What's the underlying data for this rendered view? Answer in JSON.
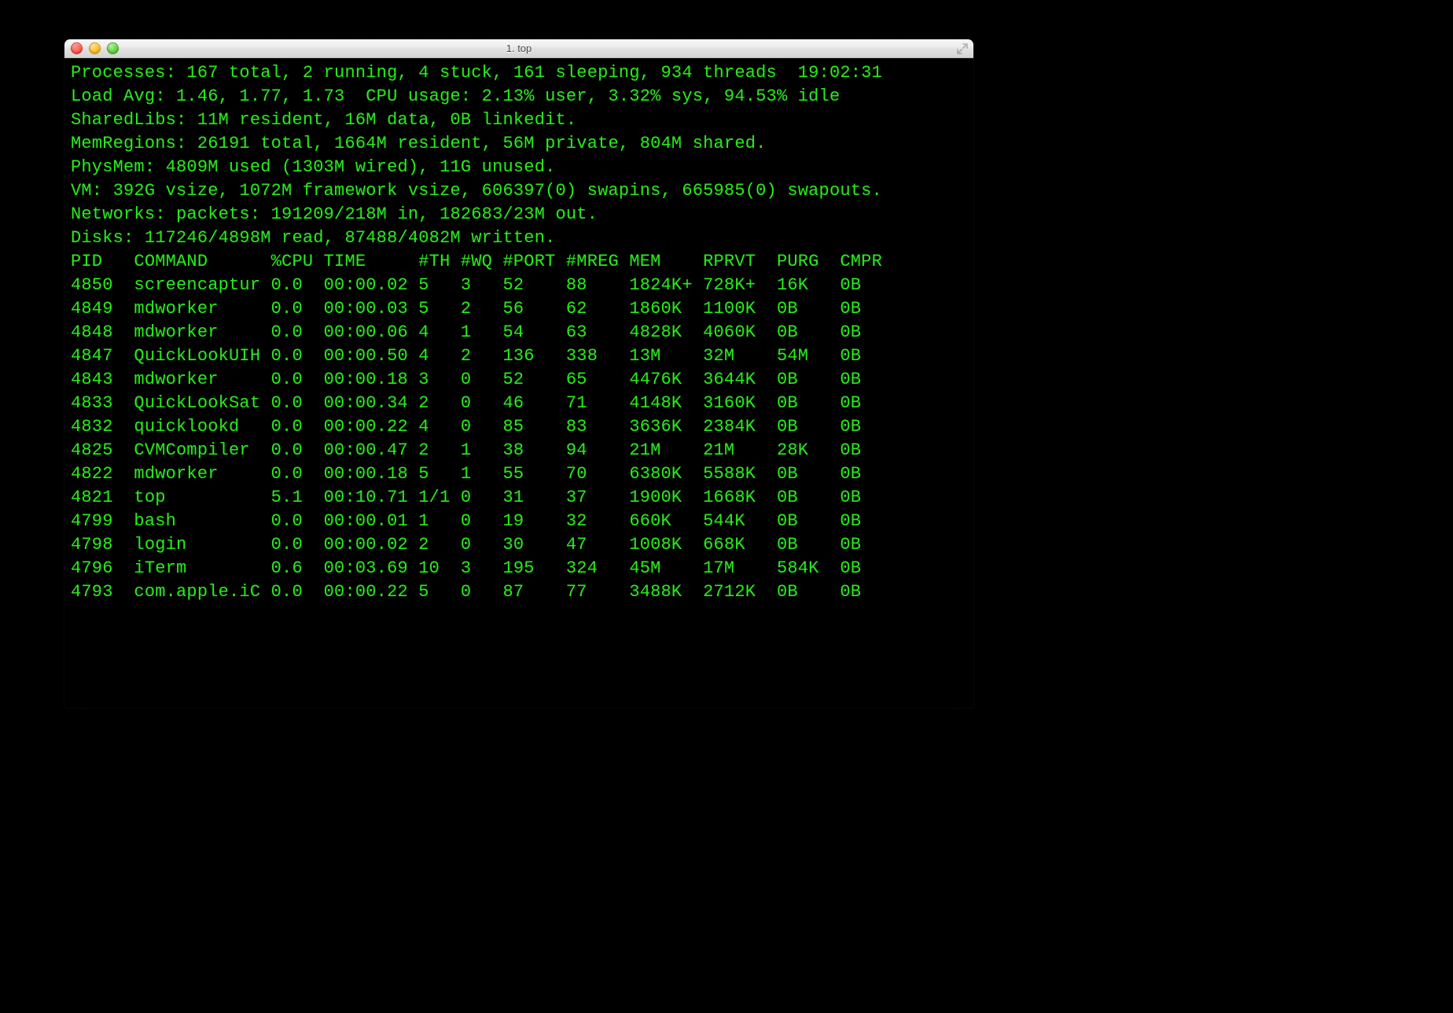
{
  "window": {
    "title": "1. top"
  },
  "summary": {
    "processes_line": {
      "prefix": "Processes: ",
      "total": "167 total",
      "running": "2 running",
      "stuck": "4 stuck",
      "sleeping": "161 sleeping",
      "threads": "934 threads",
      "clock": "19:02:31"
    },
    "load_line": "Load Avg: 1.46, 1.77, 1.73  CPU usage: 2.13% user, 3.32% sys, 94.53% idle",
    "sharedlibs_line": "SharedLibs: 11M resident, 16M data, 0B linkedit.",
    "memregions_line": "MemRegions: 26191 total, 1664M resident, 56M private, 804M shared.",
    "physmem_line": "PhysMem: 4809M used (1303M wired), 11G unused.",
    "vm_line": "VM: 392G vsize, 1072M framework vsize, 606397(0) swapins, 665985(0) swapouts.",
    "networks_line": "Networks: packets: 191209/218M in, 182683/23M out.",
    "disks_line": "Disks: 117246/4898M read, 87488/4082M written."
  },
  "columns": [
    "PID",
    "COMMAND",
    "%CPU",
    "TIME",
    "#TH",
    "#WQ",
    "#PORT",
    "#MREG",
    "MEM",
    "RPRVT",
    "PURG",
    "CMPR"
  ],
  "rows": [
    {
      "pid": "4850",
      "command": "screencaptur",
      "cpu": "0.0",
      "time": "00:00.02",
      "th": "5",
      "wq": "3",
      "port": "52",
      "mreg": "88",
      "mem": "1824K+",
      "rprvt": "728K+",
      "purg": "16K",
      "cmpr": "0B"
    },
    {
      "pid": "4849",
      "command": "mdworker",
      "cpu": "0.0",
      "time": "00:00.03",
      "th": "5",
      "wq": "2",
      "port": "56",
      "mreg": "62",
      "mem": "1860K",
      "rprvt": "1100K",
      "purg": "0B",
      "cmpr": "0B"
    },
    {
      "pid": "4848",
      "command": "mdworker",
      "cpu": "0.0",
      "time": "00:00.06",
      "th": "4",
      "wq": "1",
      "port": "54",
      "mreg": "63",
      "mem": "4828K",
      "rprvt": "4060K",
      "purg": "0B",
      "cmpr": "0B"
    },
    {
      "pid": "4847",
      "command": "QuickLookUIH",
      "cpu": "0.0",
      "time": "00:00.50",
      "th": "4",
      "wq": "2",
      "port": "136",
      "mreg": "338",
      "mem": "13M",
      "rprvt": "32M",
      "purg": "54M",
      "cmpr": "0B"
    },
    {
      "pid": "4843",
      "command": "mdworker",
      "cpu": "0.0",
      "time": "00:00.18",
      "th": "3",
      "wq": "0",
      "port": "52",
      "mreg": "65",
      "mem": "4476K",
      "rprvt": "3644K",
      "purg": "0B",
      "cmpr": "0B"
    },
    {
      "pid": "4833",
      "command": "QuickLookSat",
      "cpu": "0.0",
      "time": "00:00.34",
      "th": "2",
      "wq": "0",
      "port": "46",
      "mreg": "71",
      "mem": "4148K",
      "rprvt": "3160K",
      "purg": "0B",
      "cmpr": "0B"
    },
    {
      "pid": "4832",
      "command": "quicklookd",
      "cpu": "0.0",
      "time": "00:00.22",
      "th": "4",
      "wq": "0",
      "port": "85",
      "mreg": "83",
      "mem": "3636K",
      "rprvt": "2384K",
      "purg": "0B",
      "cmpr": "0B"
    },
    {
      "pid": "4825",
      "command": "CVMCompiler",
      "cpu": "0.0",
      "time": "00:00.47",
      "th": "2",
      "wq": "1",
      "port": "38",
      "mreg": "94",
      "mem": "21M",
      "rprvt": "21M",
      "purg": "28K",
      "cmpr": "0B"
    },
    {
      "pid": "4822",
      "command": "mdworker",
      "cpu": "0.0",
      "time": "00:00.18",
      "th": "5",
      "wq": "1",
      "port": "55",
      "mreg": "70",
      "mem": "6380K",
      "rprvt": "5588K",
      "purg": "0B",
      "cmpr": "0B"
    },
    {
      "pid": "4821",
      "command": "top",
      "cpu": "5.1",
      "time": "00:10.71",
      "th": "1/1",
      "wq": "0",
      "port": "31",
      "mreg": "37",
      "mem": "1900K",
      "rprvt": "1668K",
      "purg": "0B",
      "cmpr": "0B"
    },
    {
      "pid": "4799",
      "command": "bash",
      "cpu": "0.0",
      "time": "00:00.01",
      "th": "1",
      "wq": "0",
      "port": "19",
      "mreg": "32",
      "mem": "660K",
      "rprvt": "544K",
      "purg": "0B",
      "cmpr": "0B"
    },
    {
      "pid": "4798",
      "command": "login",
      "cpu": "0.0",
      "time": "00:00.02",
      "th": "2",
      "wq": "0",
      "port": "30",
      "mreg": "47",
      "mem": "1008K",
      "rprvt": "668K",
      "purg": "0B",
      "cmpr": "0B"
    },
    {
      "pid": "4796",
      "command": "iTerm",
      "cpu": "0.6",
      "time": "00:03.69",
      "th": "10",
      "wq": "3",
      "port": "195",
      "mreg": "324",
      "mem": "45M",
      "rprvt": "17M",
      "purg": "584K",
      "cmpr": "0B"
    },
    {
      "pid": "4793",
      "command": "com.apple.iC",
      "cpu": "0.0",
      "time": "00:00.22",
      "th": "5",
      "wq": "0",
      "port": "87",
      "mreg": "77",
      "mem": "3488K",
      "rprvt": "2712K",
      "purg": "0B",
      "cmpr": "0B"
    }
  ],
  "widths": {
    "pid": 6,
    "command": 13,
    "cpu": 4,
    "time": 9,
    "th": 4,
    "wq": 4,
    "port": 6,
    "mreg": 6,
    "mem": 7,
    "rprvt": 6,
    "purg": 5,
    "cmpr": 4
  }
}
